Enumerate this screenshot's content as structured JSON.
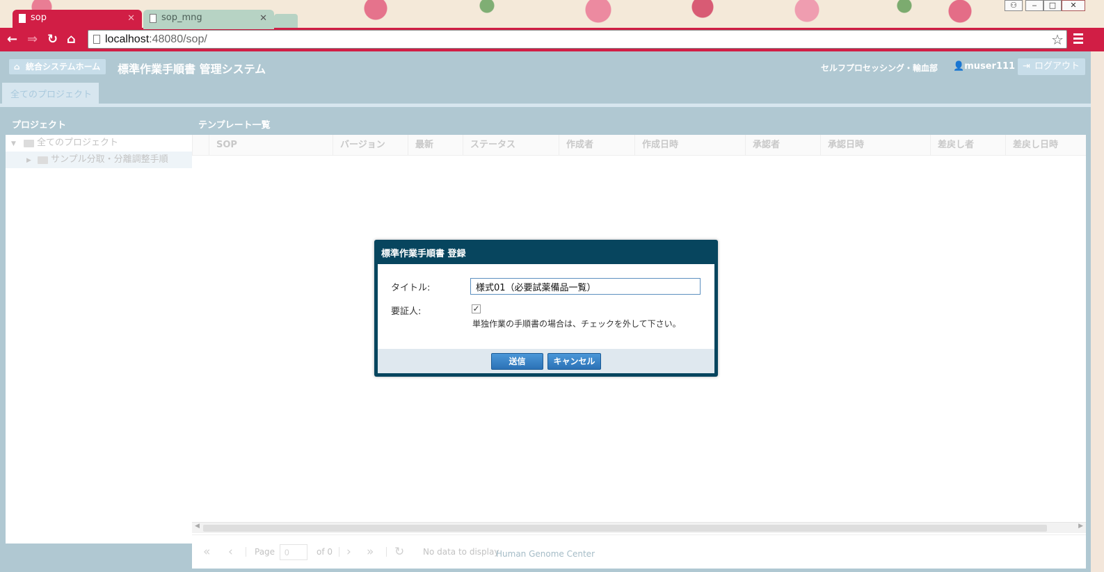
{
  "browser": {
    "tabs": [
      {
        "label": "sop",
        "active": true
      },
      {
        "label": "sop_mng",
        "active": false
      }
    ],
    "url_host": "localhost",
    "url_rest": ":48080/sop/",
    "accent": "#d11e45"
  },
  "header": {
    "home_label": "統合システムホーム",
    "app_title": "標準作業手順書 管理システム",
    "department": "セルフプロセッシング・輸血部",
    "user": "muser111",
    "logout_label": "ログアウト"
  },
  "main_tab": "全てのプロジェクト",
  "project_panel": {
    "title": "プロジェクト",
    "tree": {
      "root": "全てのプロジェクト",
      "child": "サンプル分取・分離調整手順"
    }
  },
  "template_panel": {
    "title": "テンプレート一覧",
    "columns": [
      "SOP",
      "バージョン",
      "最新",
      "ステータス",
      "作成者",
      "作成日時",
      "承認者",
      "承認日時",
      "差戻し者",
      "差戻し日時"
    ]
  },
  "pager": {
    "page_label": "Page",
    "page_value": "0",
    "of_label": "of 0",
    "status": "No data to display"
  },
  "footer": "Human Genome Center",
  "modal": {
    "title": "標準作業手順書 登録",
    "title_label": "タイトル:",
    "title_value": "様式01（必要試薬備品一覧）",
    "certifier_label": "要証人:",
    "certifier_checked": true,
    "hint": "単独作業の手順書の場合は、チェックを外して下さい。",
    "send_label": "送信",
    "cancel_label": "キャンセル"
  }
}
